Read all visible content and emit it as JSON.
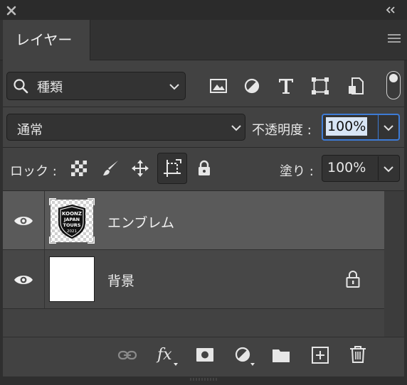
{
  "panel": {
    "tab_label": "レイヤー",
    "close_icon": "close-icon",
    "collapse_icon": "double-chevron-left-icon",
    "menu_icon": "hamburger-menu-icon"
  },
  "filter": {
    "kind_label": "種類",
    "icons": [
      "image-filter-icon",
      "adjustment-filter-icon",
      "type-filter-icon",
      "shape-filter-icon",
      "smart-object-filter-icon"
    ],
    "toggle_icon": "filter-toggle-switch"
  },
  "blend": {
    "mode": "通常",
    "opacity_label": "不透明度 :",
    "opacity_value": "100%"
  },
  "lock": {
    "label": "ロック :",
    "icons": [
      "lock-transparent-pixels-icon",
      "lock-image-pixels-icon",
      "lock-position-icon",
      "lock-artboard-icon",
      "lock-all-icon"
    ],
    "fill_label": "塗り :",
    "fill_value": "100%"
  },
  "layers": [
    {
      "name": "エンブレム",
      "visible": true,
      "selected": true,
      "locked": false,
      "emblem_text": [
        "KOONZ",
        "JAPAN",
        "TOURS",
        "2021"
      ]
    },
    {
      "name": "背景",
      "visible": true,
      "selected": false,
      "locked": true
    }
  ],
  "footer": {
    "icons": [
      "link-layers-icon",
      "fx-icon",
      "layer-mask-icon",
      "new-adjustment-layer-icon",
      "new-group-folder-icon",
      "new-layer-icon",
      "trash-icon"
    ]
  },
  "colors": {
    "accent": "#3d7bd6",
    "panel": "#424242",
    "selected_row": "#5a5a5a"
  }
}
